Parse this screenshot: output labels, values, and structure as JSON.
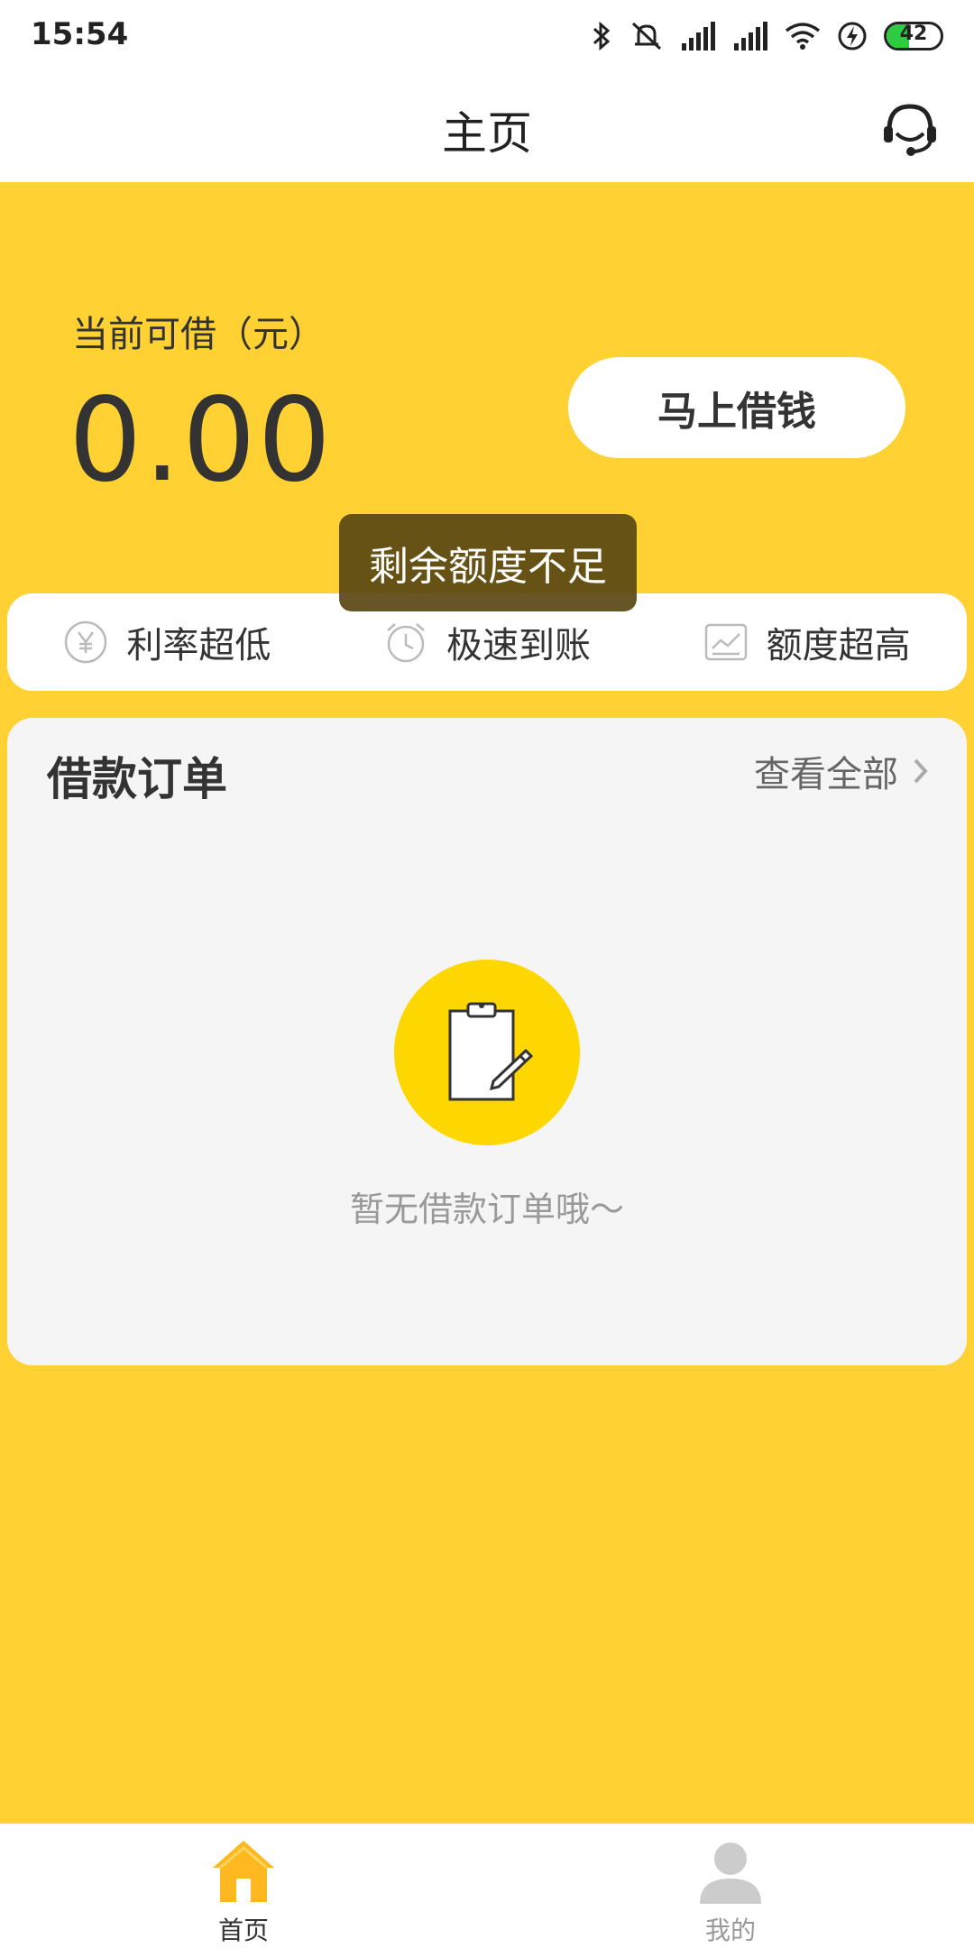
{
  "status_bar": {
    "time": "15:54",
    "battery_level": "42",
    "battery_fraction": 0.42,
    "icons": [
      "bluetooth-icon",
      "mute-icon",
      "signal-icon",
      "signal-icon",
      "wifi-icon",
      "charging-icon",
      "battery-icon"
    ]
  },
  "header": {
    "title": "主页",
    "support_icon": "headset-icon"
  },
  "hero": {
    "label": "当前可借（元）",
    "amount": "0.00",
    "borrow_button": "马上借钱"
  },
  "toast": {
    "message": "剩余额度不足"
  },
  "features": [
    {
      "label": "利率超低",
      "icon": "yuan-icon"
    },
    {
      "label": "极速到账",
      "icon": "alarm-clock-icon"
    },
    {
      "label": "额度超高",
      "icon": "trend-chart-icon"
    }
  ],
  "orders": {
    "title": "借款订单",
    "view_all": "查看全部",
    "empty_icon": "clipboard-pen-icon",
    "empty_text": "暂无借款订单哦～"
  },
  "bottom_nav": [
    {
      "label": "首页",
      "icon": "home-icon",
      "active": true
    },
    {
      "label": "我的",
      "icon": "user-icon",
      "active": false
    }
  ],
  "colors": {
    "primary": "#FFD133",
    "badge": "#FFD700",
    "home_icon": "#FFB820",
    "toast_bg": "#5A4614"
  }
}
